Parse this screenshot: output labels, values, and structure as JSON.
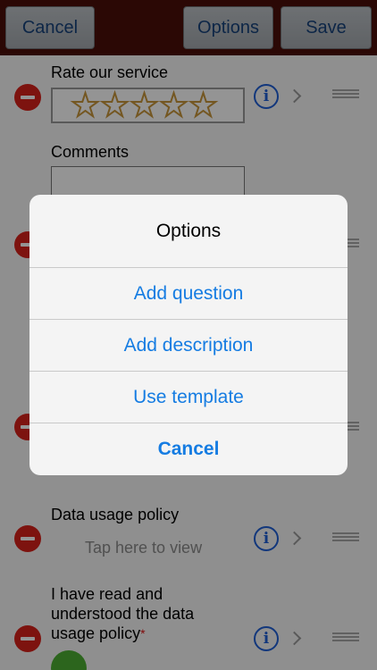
{
  "navbar": {
    "cancel_label": "Cancel",
    "options_label": "Options",
    "save_label": "Save"
  },
  "form": {
    "rating": {
      "label": "Rate our service",
      "stars_total": 5,
      "stars_filled": 0
    },
    "comments": {
      "label": "Comments"
    },
    "policy": {
      "label": "Data usage policy",
      "view_hint": "Tap here to view"
    },
    "acknowledge": {
      "label_line1": "I have read and",
      "label_line2": "understood the data",
      "label_line3": "usage policy",
      "required_mark": "*"
    }
  },
  "dialog": {
    "title": "Options",
    "buttons": [
      "Add question",
      "Add description",
      "Use template"
    ],
    "cancel_label": "Cancel"
  },
  "colors": {
    "nav_bg": "#4a0f09",
    "dialog_action": "#157ce2",
    "delete_red": "#d8221a",
    "info_blue": "#1f5fd6",
    "check_green": "#4caf32"
  }
}
